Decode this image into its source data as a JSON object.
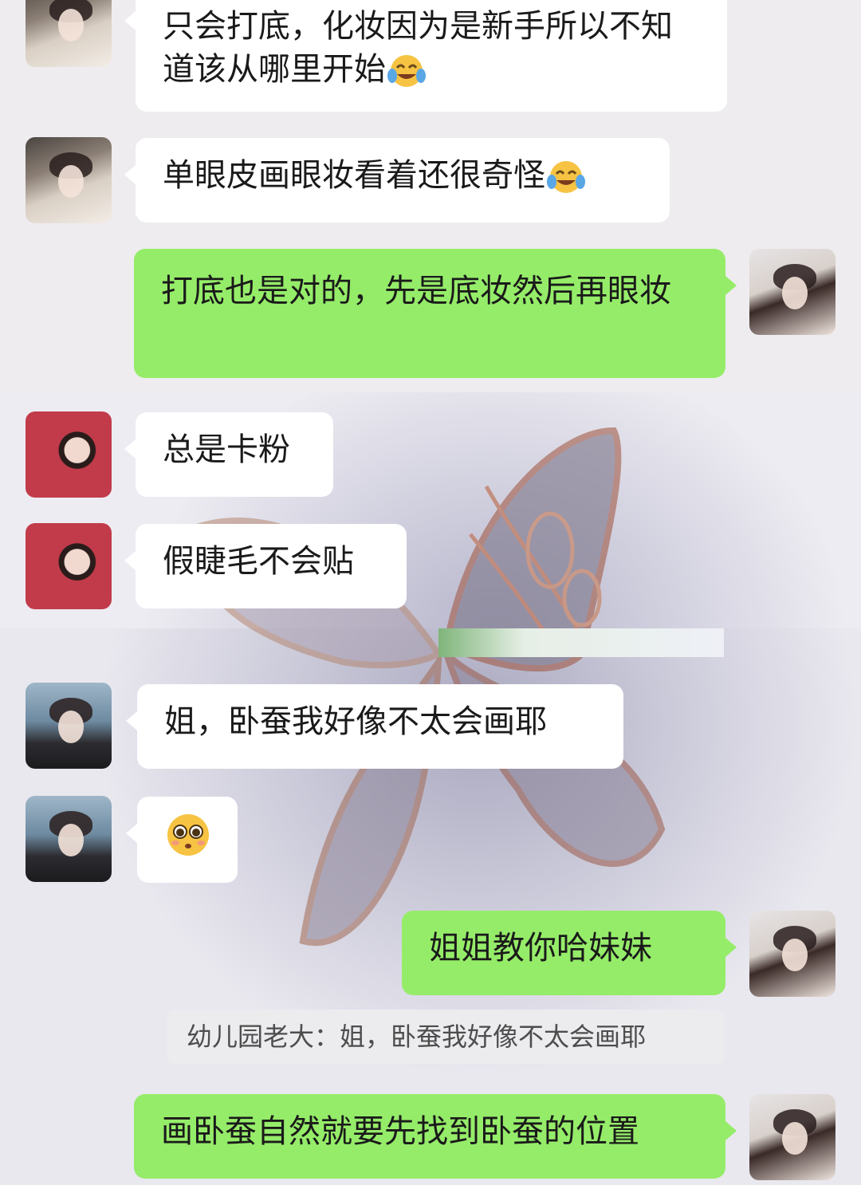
{
  "messages": [
    {
      "id": "m1",
      "side": "left",
      "avatar": "girl-selfie",
      "text": "只会打底，化妆因为是新手所以不知道该从哪里开始",
      "trail_emoji": "tears-of-joy"
    },
    {
      "id": "m2",
      "side": "left",
      "avatar": "girl-selfie",
      "text": "单眼皮画眼妆看着还很奇怪",
      "trail_emoji": "tears-of-joy"
    },
    {
      "id": "m3",
      "side": "right",
      "avatar": "me",
      "text": "打底也是对的，先是底妆然后再眼妆"
    },
    {
      "id": "m4",
      "side": "left",
      "avatar": "red-hood",
      "text": "总是卡粉"
    },
    {
      "id": "m5",
      "side": "left",
      "avatar": "red-hood",
      "text": "假睫毛不会贴"
    },
    {
      "id": "m6",
      "side": "left",
      "avatar": "seaside",
      "text": "姐，卧蚕我好像不太会画耶"
    },
    {
      "id": "m7",
      "side": "left",
      "avatar": "seaside",
      "emoji": "pleading-face"
    },
    {
      "id": "m8",
      "side": "right",
      "avatar": "me",
      "text": "姐姐教你哈妹妹"
    },
    {
      "id": "m9",
      "side": "right",
      "avatar": "me",
      "text": "画卧蚕自然就要先找到卧蚕的位置"
    }
  ],
  "quote": {
    "text": "幼儿园老大：姐，卧蚕我好像不太会画耶"
  },
  "colors": {
    "bubble_in": "#ffffff",
    "bubble_out": "#95ec69",
    "quote_bg": "#ecebee",
    "text": "#1a1a1a"
  }
}
